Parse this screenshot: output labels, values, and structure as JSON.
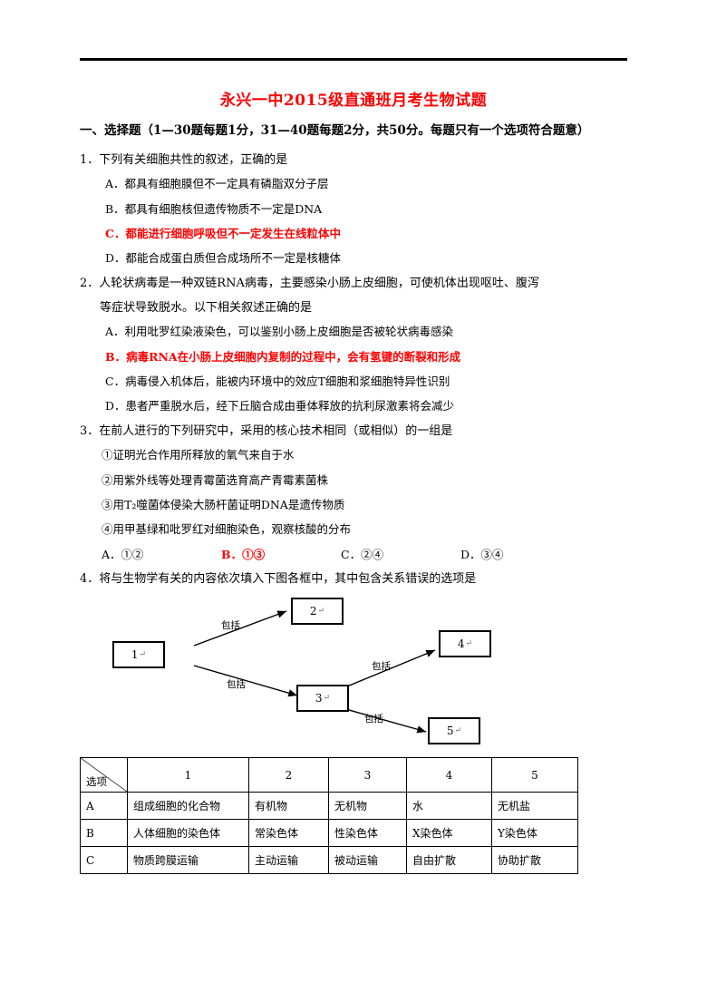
{
  "document": {
    "title": "永兴一中2015级直通班月考生物试题",
    "section_heading": "一、选择题（1—30题每题1分，31—40题每题2分，共50分。每题只有一个选项符合题意）"
  },
  "questions": [
    {
      "number": "1．",
      "stem": "下列有关细胞共性的叙述，正确的是",
      "options": [
        {
          "label": "A．",
          "text": "都具有细胞膜但不一定具有磷脂双分子层",
          "highlight": false
        },
        {
          "label": "B．",
          "text": "都具有细胞核但遗传物质不一定是DNA",
          "highlight": false
        },
        {
          "label": "C．",
          "text": "都能进行细胞呼吸但不一定发生在线粒体中",
          "highlight": true
        },
        {
          "label": "D．",
          "text": "都能合成蛋白质但合成场所不一定是核糖体",
          "highlight": false
        }
      ]
    },
    {
      "number": "2．",
      "stem": "人轮状病毒是一种双链RNA病毒，主要感染小肠上皮细胞，可使机体出现呕吐、腹泻",
      "stem_cont": "等症状导致脱水。以下相关叙述正确的是",
      "options": [
        {
          "label": "A．",
          "text": "利用吡罗红染液染色，可以鉴别小肠上皮细胞是否被轮状病毒感染",
          "highlight": false
        },
        {
          "label": "B．",
          "text": "病毒RNA在小肠上皮细胞内复制的过程中，会有氢键的断裂和形成",
          "highlight": true
        },
        {
          "label": "C．",
          "text": "病毒侵入机体后，能被内环境中的效应T细胞和浆细胞特异性识别",
          "highlight": false
        },
        {
          "label": "D．",
          "text": "患者严重脱水后，经下丘脑合成由垂体释放的抗利尿激素将会减少",
          "highlight": false
        }
      ]
    },
    {
      "number": "3．",
      "stem": "在前人进行的下列研究中，采用的核心技术相同（或相似）的一组是",
      "sub_items": [
        "①证明光合作用所释放的氧气来自于水",
        "②用紫外线等处理青霉菌选育高产青霉素菌株",
        "③用T₂噬菌体侵染大肠杆菌证明DNA是遗传物质",
        "④用甲基绿和吡罗红对细胞染色，观察核酸的分布"
      ],
      "answer_row": [
        {
          "label": "A．",
          "text": "①②",
          "highlight": false
        },
        {
          "label": "B．",
          "text": "①③",
          "highlight": true
        },
        {
          "label": "C．",
          "text": "②④",
          "highlight": false
        },
        {
          "label": "D．",
          "text": "③④",
          "highlight": false
        }
      ]
    },
    {
      "number": "4．",
      "stem": "将与生物学有关的内容依次填入下图各框中，其中包含关系错误的选项是"
    }
  ],
  "diagram": {
    "boxes": [
      {
        "id": "box1",
        "label": "1"
      },
      {
        "id": "box2",
        "label": "2"
      },
      {
        "id": "box3",
        "label": "3"
      },
      {
        "id": "box4",
        "label": "4"
      },
      {
        "id": "box5",
        "label": "5"
      }
    ],
    "edge_label": "包括",
    "cr_mark": "↵"
  },
  "table": {
    "corner_label": "选项",
    "headers": [
      "1",
      "2",
      "3",
      "4",
      "5"
    ],
    "rows": [
      {
        "option": "A",
        "cells": [
          "组成细胞的化合物",
          "有机物",
          "无机物",
          "水",
          "无机盐"
        ]
      },
      {
        "option": "B",
        "cells": [
          "人体细胞的染色体",
          "常染色体",
          "性染色体",
          "X染色体",
          "Y染色体"
        ]
      },
      {
        "option": "C",
        "cells": [
          "物质跨膜运输",
          "主动运输",
          "被动运输",
          "自由扩散",
          "协助扩散"
        ]
      }
    ]
  }
}
